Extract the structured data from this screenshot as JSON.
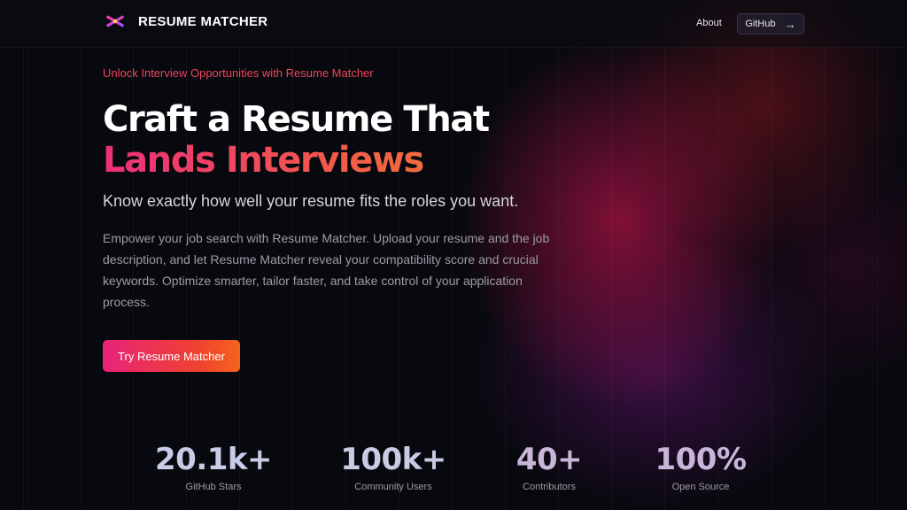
{
  "header": {
    "brand": "RESUME MATCHER",
    "nav": {
      "about": "About",
      "github": "GitHub",
      "github_arrow": "→"
    }
  },
  "hero": {
    "eyebrow": "Unlock Interview Opportunities with Resume Matcher",
    "title_line1": "Craft a Resume That",
    "title_line2": "Lands Interviews",
    "subhead": "Know exactly how well your resume fits the roles you want.",
    "body": "Empower your job search with Resume Matcher. Upload your resume and the job description, and let Resume Matcher reveal your compatibility score and crucial keywords. Optimize smarter, tailor faster, and take control of your application process.",
    "cta": "Try Resume Matcher"
  },
  "stats": [
    {
      "value": "20.1k+",
      "label": "GitHub Stars"
    },
    {
      "value": "100k+",
      "label": "Community Users"
    },
    {
      "value": "40+",
      "label": "Contributors"
    },
    {
      "value": "100%",
      "label": "Open Source"
    }
  ],
  "colors": {
    "background": "#08090f",
    "accent_pink": "#ec2f7a",
    "accent_orange": "#f5651e",
    "eyebrow": "#f0455a"
  },
  "icons": {
    "logo": "asterisk-logo-icon",
    "github_link": "arrow-right-icon"
  }
}
